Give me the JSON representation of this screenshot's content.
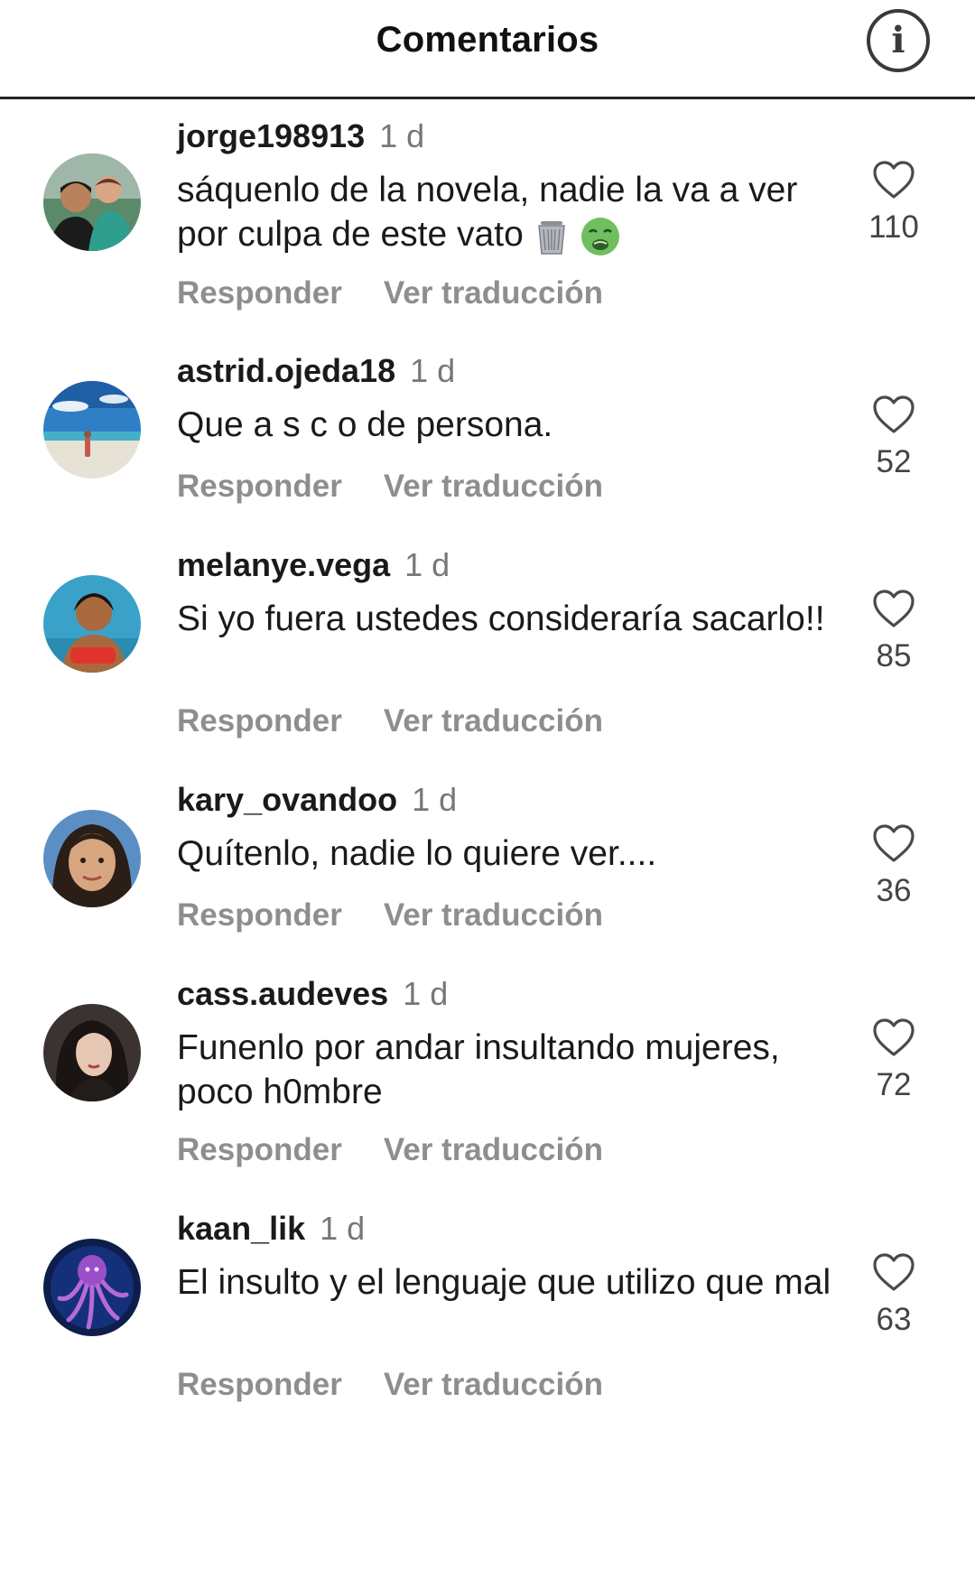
{
  "header": {
    "title": "Comentarios",
    "info_icon": "info-circle-icon"
  },
  "labels": {
    "reply": "Responder",
    "translate": "Ver traducción"
  },
  "colors": {
    "text": "#1a1a1a",
    "muted": "#8e8e8e",
    "timestamp": "#777777"
  },
  "comments": [
    {
      "username": "jorge198913",
      "time": "1 d",
      "text": "sáquenlo de la novela, nadie la va a ver por culpa de este vato",
      "emojis": [
        "wastebasket-emoji",
        "nauseated-face-emoji"
      ],
      "likes": "110"
    },
    {
      "username": "astrid.ojeda18",
      "time": "1 d",
      "text": "Que a s c o de persona.",
      "likes": "52"
    },
    {
      "username": "melanye.vega",
      "time": "1 d",
      "text": "Si yo fuera ustedes consideraría sacarlo!!",
      "likes": "85"
    },
    {
      "username": "kary_ovandoo",
      "time": "1 d",
      "text": "Quítenlo, nadie lo quiere ver....",
      "likes": "36"
    },
    {
      "username": "cass.audeves",
      "time": "1 d",
      "text": "Funenlo por andar insultando mujeres, poco h0mbre",
      "likes": "72"
    },
    {
      "username": "kaan_lik",
      "time": "1 d",
      "text": "El insulto y el lenguaje que utilizo que mal",
      "likes": "63"
    }
  ]
}
